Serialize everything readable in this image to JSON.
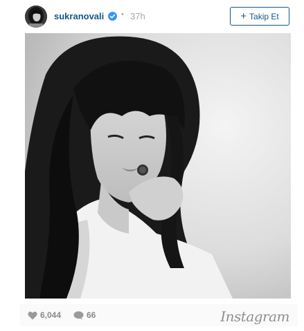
{
  "post": {
    "username": "sukranovali",
    "separator": "•",
    "time": "37h",
    "follow_label": "Takip Et",
    "likes": "6,044",
    "comments": "66",
    "brand": "Instagram"
  },
  "icons": {
    "verified": "verified-badge-icon",
    "like": "heart-icon",
    "comment": "comment-bubble-icon",
    "plus": "plus-icon"
  },
  "colors": {
    "link": "#125688",
    "muted": "#a5a7aa",
    "footer_bg": "#fafafa",
    "verified": "#3897f0"
  }
}
